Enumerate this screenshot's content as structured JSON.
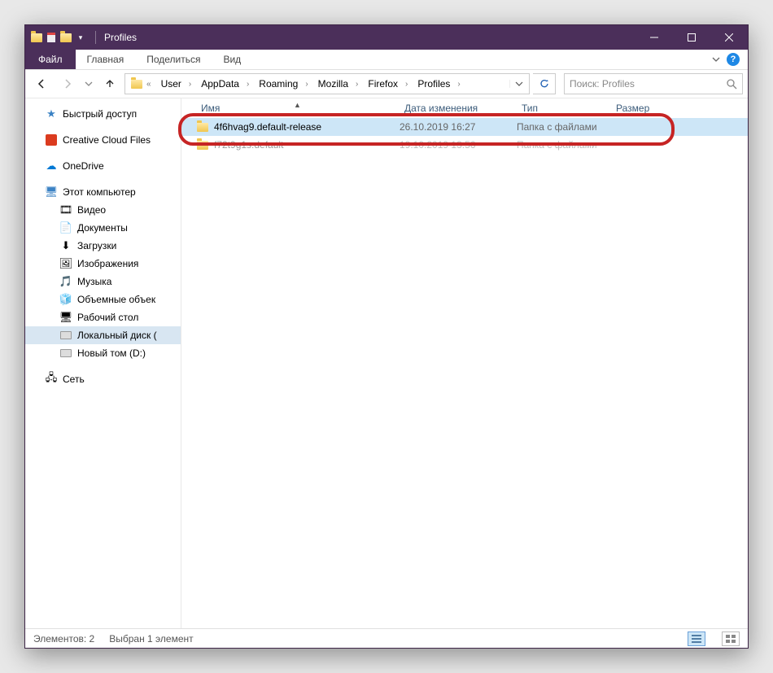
{
  "titlebar": {
    "title": "Profiles"
  },
  "ribbon": {
    "file": "Файл",
    "tabs": [
      "Главная",
      "Поделиться",
      "Вид"
    ]
  },
  "breadcrumb": {
    "segments": [
      "User",
      "AppData",
      "Roaming",
      "Mozilla",
      "Firefox",
      "Profiles"
    ]
  },
  "search": {
    "placeholder": "Поиск: Profiles"
  },
  "sidebar": {
    "quick_access": "Быстрый доступ",
    "creative_cloud": "Creative Cloud Files",
    "onedrive": "OneDrive",
    "this_pc": "Этот компьютер",
    "videos": "Видео",
    "documents": "Документы",
    "downloads": "Загрузки",
    "pictures": "Изображения",
    "music": "Музыка",
    "volumes3d": "Объемные объек",
    "desktop": "Рабочий стол",
    "local_disk": "Локальный диск (",
    "new_volume": "Новый том (D:)",
    "network": "Сеть"
  },
  "columns": {
    "name": "Имя",
    "date": "Дата изменения",
    "type": "Тип",
    "size": "Размер"
  },
  "rows": [
    {
      "name": "4f6hvag9.default-release",
      "date": "26.10.2019 16:27",
      "type": "Папка с файлами",
      "selected": true
    },
    {
      "name": "f72t9g1s.default",
      "date": "19.10.2019 13:56",
      "type": "Папка с файлами",
      "selected": false
    }
  ],
  "status": {
    "items": "Элементов: 2",
    "selected": "Выбран 1 элемент"
  }
}
